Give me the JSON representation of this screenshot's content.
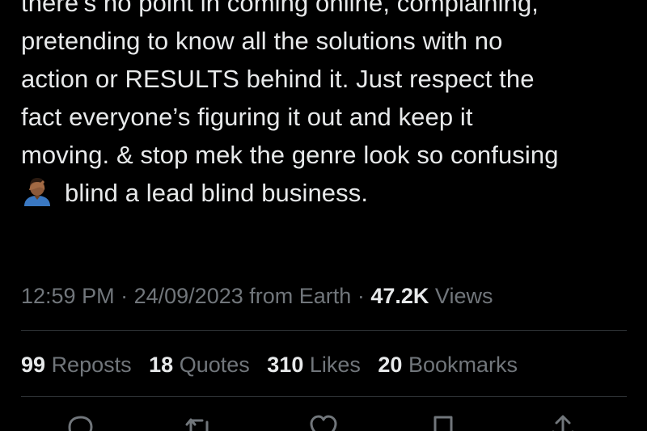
{
  "tweet": {
    "lines": [
      "there’s no point in coming online, complaining,",
      "pretending to know all the solutions with no",
      "action or RESULTS behind it. Just respect the",
      "fact everyone’s figuring it out and keep it",
      "moving. & stop mek the genre look so confusing",
      "blind a lead blind business."
    ],
    "emoji": "man-facepalming-emoji"
  },
  "meta": {
    "time": "12:59 PM",
    "separator": "·",
    "date": "24/09/2023",
    "from_label": "from Earth",
    "views_count": "47.2K",
    "views_label": "Views"
  },
  "stats": {
    "reposts_count": "99",
    "reposts_label": "Reposts",
    "quotes_count": "18",
    "quotes_label": "Quotes",
    "likes_count": "310",
    "likes_label": "Likes",
    "bookmarks_count": "20",
    "bookmarks_label": "Bookmarks"
  },
  "actions": [
    {
      "icon": "reply-icon"
    },
    {
      "icon": "repost-icon"
    },
    {
      "icon": "like-icon"
    },
    {
      "icon": "bookmark-icon"
    },
    {
      "icon": "share-icon"
    }
  ],
  "colors": {
    "background": "#000000",
    "text_primary": "#e7e9ea",
    "text_secondary": "#71767b",
    "divider": "#2f3336"
  }
}
